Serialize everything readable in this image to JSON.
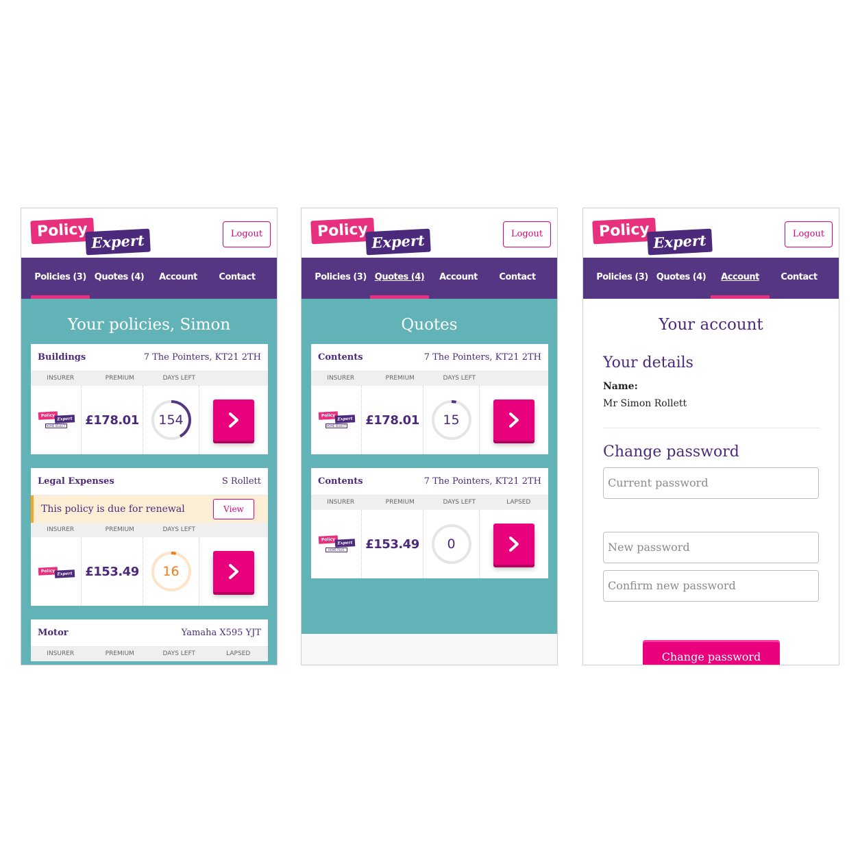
{
  "brand": {
    "logo_policy": "Policy",
    "logo_expert": "Expert",
    "mini_home_select": "HOME SELECT",
    "mini_home_plus": "HOME PLUS"
  },
  "header": {
    "logout_label": "Logout"
  },
  "nav": {
    "policies": "Policies (3)",
    "quotes": "Quotes (4)",
    "account": "Account",
    "contact": "Contact"
  },
  "columns": {
    "insurer": "Insurer",
    "premium": "Premium",
    "days_left": "Days left",
    "lapsed": "Lapsed"
  },
  "colors": {
    "purple": "#543683",
    "pink": "#e8007c",
    "teal": "#62b3b8",
    "orange": "#f07b1a"
  },
  "policies_screen": {
    "title": "Your policies, Simon",
    "cards": [
      {
        "type": "Buildings",
        "address": "7 The Pointers, KT21 2TH",
        "premium": "£178.01",
        "days_left": "154",
        "days_fraction": 0.42
      },
      {
        "type": "Legal Expenses",
        "address": "S Rollett",
        "renewal_text": "This policy is due for renewal",
        "view_label": "View",
        "premium": "£153.49",
        "days_left": "16",
        "days_fraction": 0.04
      },
      {
        "type": "Motor",
        "address": "Yamaha X595 YJT"
      }
    ]
  },
  "quotes_screen": {
    "title": "Quotes",
    "cards": [
      {
        "type": "Contents",
        "address": "7 The Pointers, KT21 2TH",
        "premium": "£178.01",
        "days_left": "15",
        "days_fraction": 0.04
      },
      {
        "type": "Contents",
        "address": "7 The Pointers, KT21 2TH",
        "premium": "£153.49",
        "days_left": "0",
        "days_fraction": 0
      }
    ]
  },
  "account_screen": {
    "title": "Your account",
    "details_heading": "Your details",
    "name_label": "Name:",
    "name_value": "Mr Simon Rollett",
    "change_heading": "Change password",
    "current_placeholder": "Current password",
    "new_placeholder": "New password",
    "confirm_placeholder": "Confirm new password",
    "submit_label": "Change password"
  }
}
